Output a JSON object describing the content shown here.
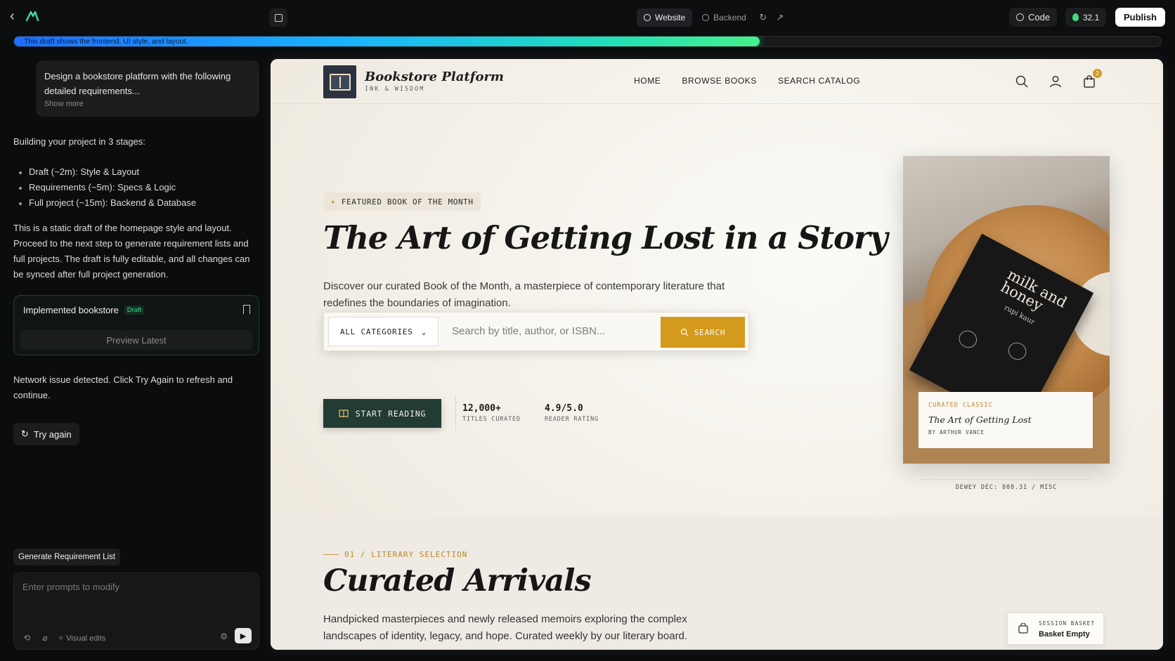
{
  "topbar": {
    "tabs": [
      {
        "label": "Website",
        "active": true
      },
      {
        "label": "Backend",
        "active": false
      }
    ],
    "code_label": "Code",
    "credits": "32.1",
    "publish_label": "Publish"
  },
  "progress": {
    "text": "This draft shows the frontend, UI style, and layout.",
    "fraction": 0.65
  },
  "left": {
    "prompt_text": "Design a bookstore platform with the following detailed requirements...",
    "show_more": "Show more",
    "stages_intro": "Building your project in 3 stages:",
    "stages": [
      "Draft (~2m): Style & Layout",
      "Requirements (~5m): Specs & Logic",
      "Full project (~15m): Backend & Database"
    ],
    "draft_note": "This is a static draft of the homepage style and layout. Proceed to the next step to generate requirement lists and full projects. The draft is fully editable, and all changes can be synced after full project generation.",
    "impl_title": "Implemented bookstore",
    "impl_badge": "Draft",
    "preview_latest": "Preview Latest",
    "network_msg": "Network issue detected. Click Try Again to refresh and continue.",
    "try_again": "Try again",
    "gen_req": "Generate Requirement List",
    "composer_placeholder": "Enter prompts to modify",
    "visual_edits": "Visual edits"
  },
  "site": {
    "brand": "Bookstore Platform",
    "tagline": "INK & WISDOM",
    "menu": [
      "HOME",
      "BROWSE BOOKS",
      "SEARCH CATALOG"
    ],
    "cart_count": "2",
    "featured_label": "FEATURED BOOK OF THE MONTH",
    "hero_title": "The Art of Getting Lost in a Story",
    "hero_sub": "Discover our curated Book of the Month, a masterpiece of contemporary literature that redefines the boundaries of imagination.",
    "category_label": "ALL CATEGORIES",
    "search_placeholder": "Search by title, author, or ISBN...",
    "search_label": "SEARCH",
    "start_reading": "START READING",
    "stats": [
      {
        "value": "12,000+",
        "label": "TITLES CURATED"
      },
      {
        "value": "4.9/5.0",
        "label": "READER RATING"
      }
    ],
    "cover_title": "milk and honey",
    "cover_author": "rupi kaur",
    "card_kicker": "CURATED CLASSIC",
    "card_title": "The Art of Getting Lost",
    "card_author": "BY ARTHUR VANCE",
    "dewey": "DEWEY DEC: 808.31 / MISC",
    "section_eyebrow": "01 / LITERARY SELECTION",
    "section_title": "Curated Arrivals",
    "section_sub": "Handpicked masterpieces and newly released memoirs exploring the complex landscapes of identity, legacy, and hope. Curated weekly by our literary board.",
    "basket_label": "SESSION BASKET",
    "basket_value": "Basket Empty"
  }
}
